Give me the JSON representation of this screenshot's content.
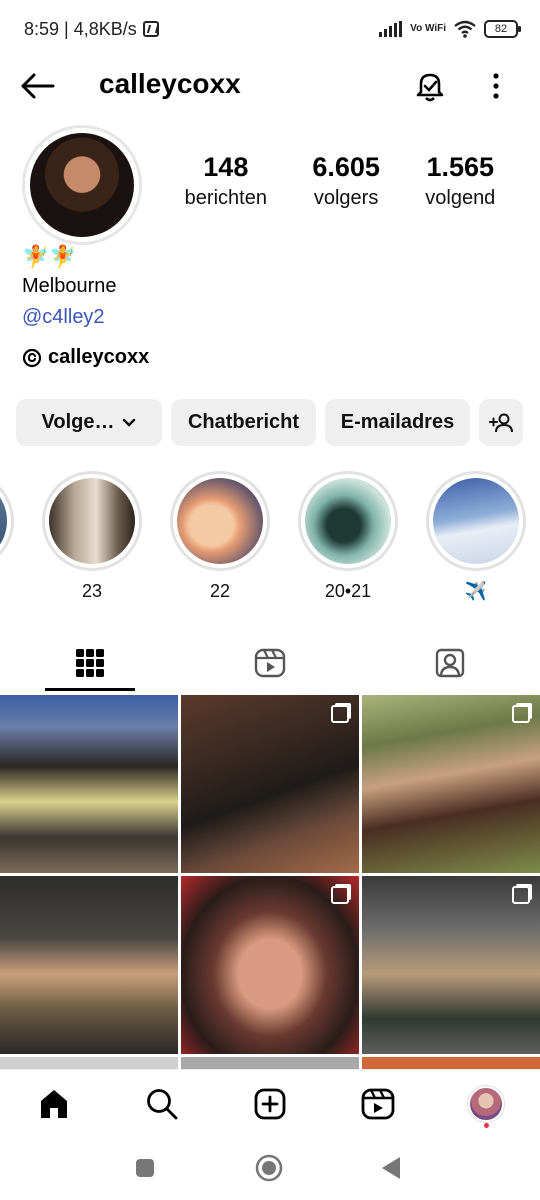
{
  "status_bar": {
    "time_speed": "8:59 | 4,8KB/s",
    "network_label": "Vo WiFi",
    "battery": "82"
  },
  "header": {
    "username": "calleycoxx",
    "icons": [
      "back-arrow-icon",
      "notification-bell-icon",
      "more-options-icon"
    ]
  },
  "profile": {
    "stats": [
      {
        "value": "148",
        "label": "berichten"
      },
      {
        "value": "6.605",
        "label": "volgers"
      },
      {
        "value": "1.565",
        "label": "volgend"
      }
    ],
    "bio_emoji": "🧚🧚",
    "location": "Melbourne",
    "link": "@c4lley2",
    "threads_handle": "calleycoxx"
  },
  "actions": {
    "follow_label": "Volge…",
    "chat_label": "Chatbericht",
    "email_label": "E-mailadres",
    "add_user_icon": "add-user-icon"
  },
  "highlights": [
    {
      "label": "23"
    },
    {
      "label": "22"
    },
    {
      "label": "20•21"
    },
    {
      "label": "✈️"
    }
  ],
  "tabs": [
    "grid-icon",
    "reels-icon",
    "tagged-icon"
  ],
  "bottom_nav": [
    "home-icon",
    "search-icon",
    "create-icon",
    "reels-icon",
    "profile-avatar"
  ],
  "system_nav": [
    "recents-button",
    "home-button",
    "back-button"
  ]
}
